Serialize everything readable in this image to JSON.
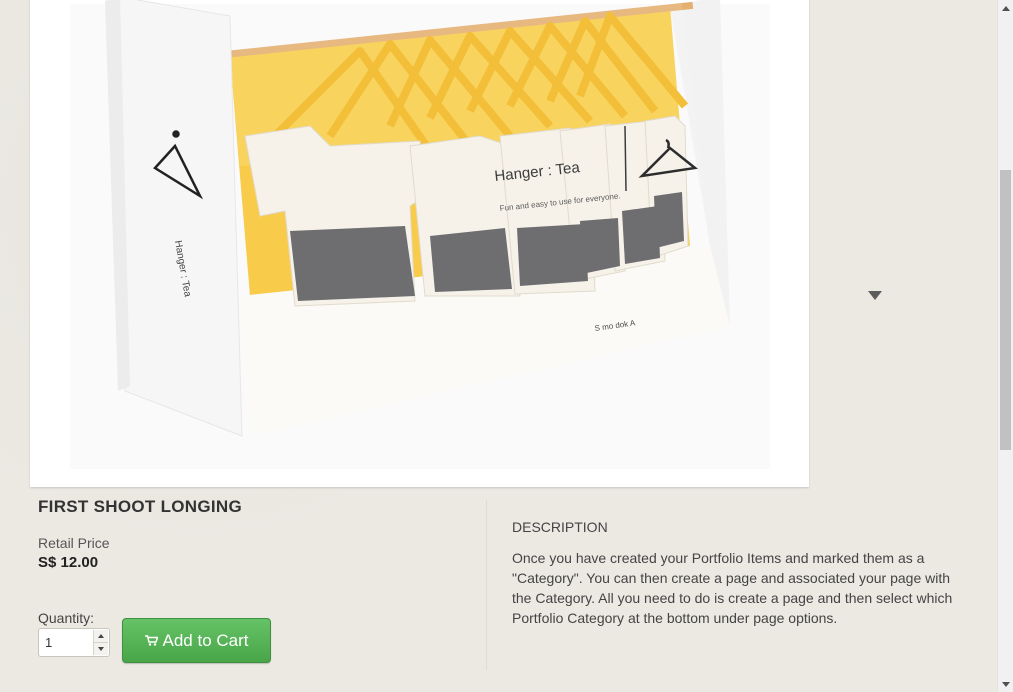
{
  "product": {
    "title": "FIRST SHOOT LONGING",
    "price_label": "Retail Price",
    "price": "S$ 12.00",
    "image_text": {
      "brand": "Hanger : Tea",
      "side_brand": "Hanger : Tea",
      "tagline": "Fun and easy to use for everyone.",
      "maker": "S mo dok A"
    }
  },
  "cart": {
    "quantity_label": "Quantity:",
    "quantity_value": "1",
    "add_label": "Add to Cart"
  },
  "description": {
    "heading": "DESCRIPTION",
    "text": "Once you have created your Portfolio Items and marked them as a \"Category\". You can then create a page and associated your page with the Category. All you need to do is create a page and then select which Portfolio Category at the bottom under page options."
  },
  "colors": {
    "accent_green": "#5cb85c",
    "tea_yellow": "#f5c12a"
  }
}
